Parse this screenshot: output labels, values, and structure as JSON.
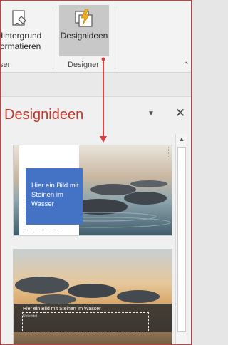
{
  "ribbon": {
    "format_background_button": "Hintergrund formatieren",
    "designer_button": "Designideen",
    "left_group_label": "sen",
    "designer_group_label": "Designer",
    "collapse_icon": "chevron-up-icon"
  },
  "pane": {
    "title": "Designideen",
    "menu_icon": "dropdown-triangle-icon",
    "close_icon": "close-icon",
    "thumbnails": [
      {
        "text": "Hier ein Bild mit Steinen im Wasser"
      },
      {
        "title": "Hier ein Bild mit Steinen im Wasser",
        "subtitle": "Untertitel"
      }
    ]
  },
  "colors": {
    "annotation_red": "#e03c3c",
    "pane_title": "#c0392b",
    "accent_blue": "#4472c4"
  }
}
